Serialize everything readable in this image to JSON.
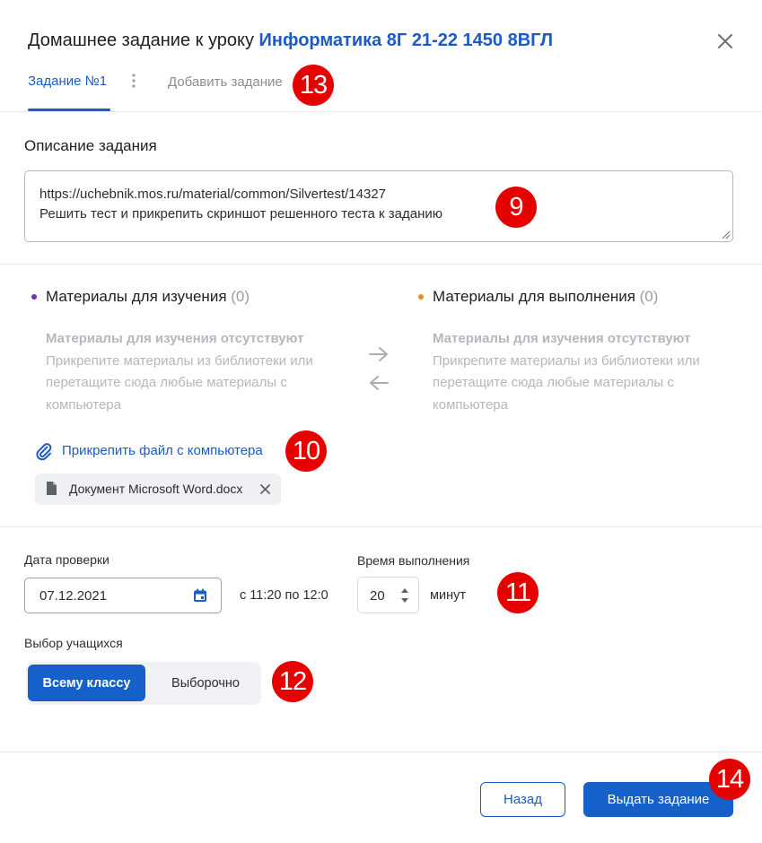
{
  "header": {
    "title_prefix": "Домашнее задание к уроку",
    "lesson_name": "Информатика 8Г 21-22 1450 8ВГЛ"
  },
  "tabs": {
    "active_label": "Задание №1",
    "add_label": "Добавить задание"
  },
  "description": {
    "label": "Описание задания",
    "line1": "https://uchebnik.mos.ru/material/common/Silvertest/14327",
    "line2": "Решить тест и прикрепить скриншот решенного теста к заданию"
  },
  "materials": {
    "study": {
      "title": "Материалы для изучения",
      "count": "(0)",
      "empty_title": "Материалы для изучения отсутствуют",
      "empty_text": "Прикрепите материалы из библиотеки или перетащите сюда любые материалы с компьютера",
      "dot_color": "#7a2bb8"
    },
    "exec": {
      "title": "Материалы для выполнения",
      "count": "(0)",
      "empty_title": "Материалы для изучения отсутствуют",
      "empty_text": "Прикрепите материалы из библиотеки или перетащите сюда любые материалы с компьютера",
      "dot_color": "#f08a24"
    },
    "attach_label": "Прикрепить файл с компьютера",
    "file_name": "Документ Microsoft Word.docx"
  },
  "schedule": {
    "date_label": "Дата проверки",
    "date_value": "07.12.2021",
    "time_range": "с 11:20 по 12:0",
    "duration_label": "Время выполнения",
    "duration_value": "20",
    "duration_unit": "минут"
  },
  "students": {
    "label": "Выбор учащихся",
    "option_all": "Всему классу",
    "option_select": "Выборочно"
  },
  "footer": {
    "back_label": "Назад",
    "submit_label": "Выдать задание"
  },
  "annotations": {
    "b9": "9",
    "b10": "10",
    "b11": "11",
    "b12": "12",
    "b13": "13",
    "b14": "14"
  },
  "colors": {
    "accent": "#1a5bc8",
    "primary_button": "#1560c9",
    "marker": "#e60000"
  }
}
